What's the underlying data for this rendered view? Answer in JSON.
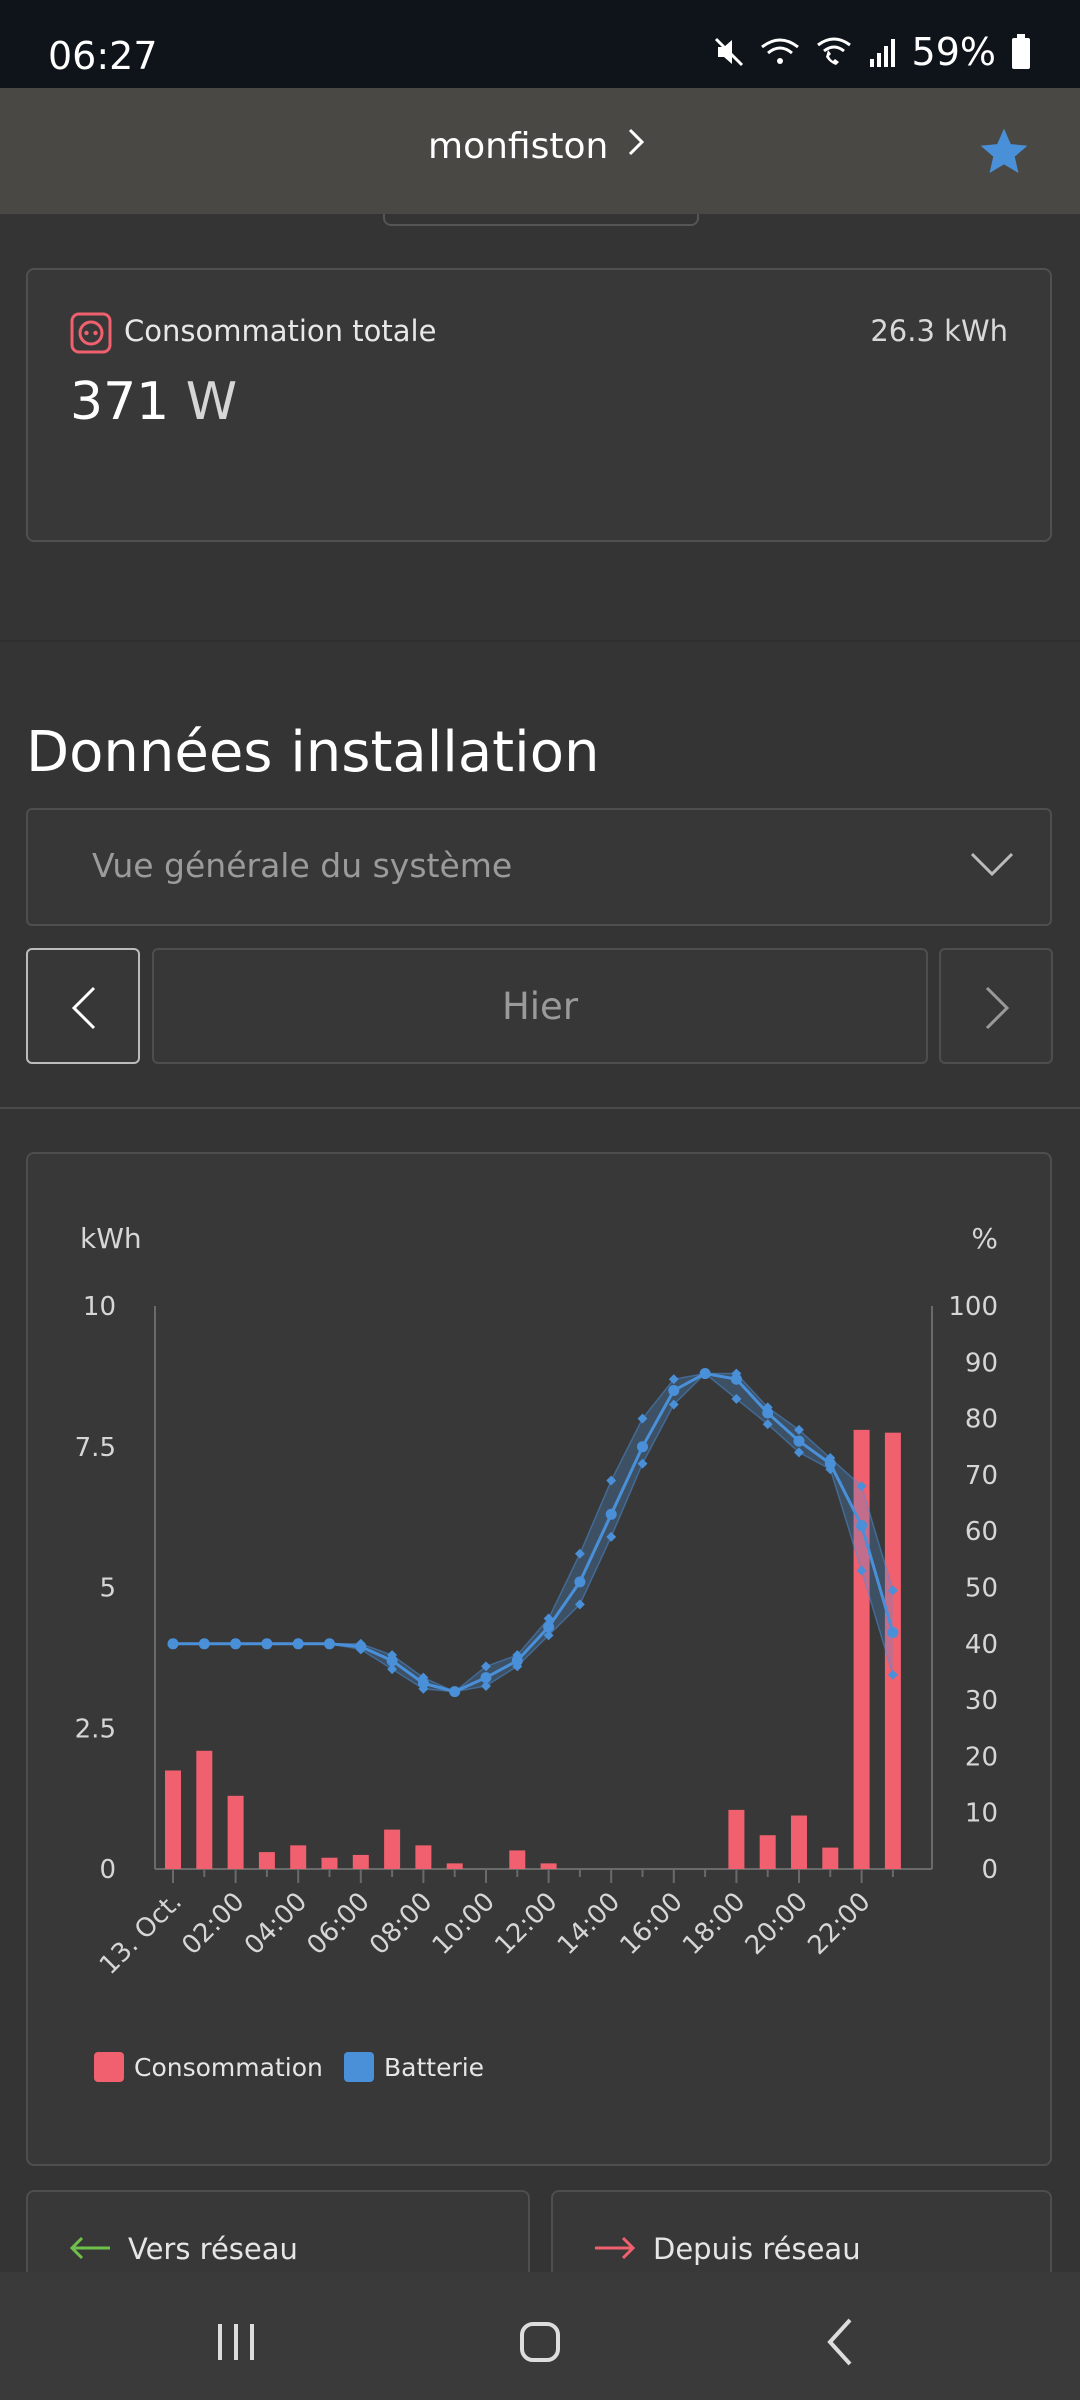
{
  "status": {
    "time": "06:27",
    "battery": "59%"
  },
  "header": {
    "title": "monfiston"
  },
  "consumption_card": {
    "title": "Consommation totale",
    "total": "26.3 kWh",
    "power_value": "371",
    "power_unit": "W"
  },
  "section": {
    "title": "Données installation",
    "dropdown_value": "Vue générale du système",
    "date_label": "Hier"
  },
  "chart_data": {
    "type": "bar",
    "y_left_label": "kWh",
    "y_right_label": "%",
    "y_left_ticks": [
      "10",
      "7.5",
      "5",
      "2.5",
      "0"
    ],
    "y_right_ticks": [
      "100",
      "90",
      "80",
      "70",
      "60",
      "50",
      "40",
      "30",
      "20",
      "10",
      "0"
    ],
    "ylim_left": [
      0,
      10
    ],
    "ylim_right": [
      0,
      100
    ],
    "x_tick_labels": [
      "13. Oct.",
      "02:00",
      "04:00",
      "06:00",
      "08:00",
      "10:00",
      "12:00",
      "14:00",
      "16:00",
      "18:00",
      "20:00",
      "22:00"
    ],
    "hours": [
      0,
      1,
      2,
      3,
      4,
      5,
      6,
      7,
      8,
      9,
      10,
      11,
      12,
      13,
      14,
      15,
      16,
      17,
      18,
      19,
      20,
      21,
      22,
      23
    ],
    "series": [
      {
        "name": "Consommation",
        "axis": "left",
        "color": "#f0606e",
        "values": [
          1.75,
          2.1,
          1.3,
          0.3,
          0.42,
          0.2,
          0.25,
          0.7,
          0.42,
          0.1,
          0,
          0.33,
          0.1,
          0,
          0,
          0,
          0,
          0,
          1.05,
          0.6,
          0.95,
          0.38,
          7.8,
          7.75
        ]
      },
      {
        "name": "Batterie",
        "axis": "right",
        "color": "#4a90d9",
        "values": [
          40,
          40,
          40,
          40,
          40,
          40,
          39.5,
          37,
          33,
          31.5,
          34,
          37,
          43,
          51,
          63,
          75,
          85,
          88,
          87,
          81,
          76,
          72,
          61,
          42
        ],
        "min_values": [
          40,
          40,
          40,
          40,
          40,
          40,
          39,
          35.5,
          32,
          31.5,
          32.5,
          36,
          41.5,
          47,
          59,
          72,
          82.5,
          88,
          83.5,
          79,
          74,
          71,
          53,
          34.5
        ],
        "max_values": [
          40,
          40,
          40,
          40,
          40,
          40,
          40,
          38,
          34,
          31.5,
          36,
          38,
          44.5,
          56,
          69,
          80,
          87,
          88,
          88,
          82,
          78,
          73,
          68,
          49.5
        ]
      }
    ],
    "legend": [
      "Consommation",
      "Batterie"
    ],
    "legend_position": "bottom-left"
  },
  "bottom_cards": {
    "left": "Vers réseau",
    "right": "Depuis réseau"
  }
}
